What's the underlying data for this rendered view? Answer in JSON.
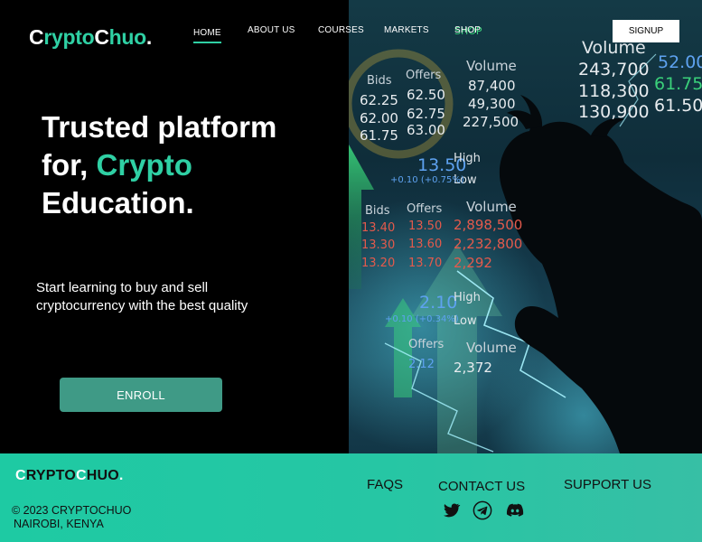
{
  "header": {
    "logo_first": "C",
    "logo_mid": "rypto",
    "logo_c2": "C",
    "logo_rest": "huo",
    "logo_dot": ".",
    "nav": [
      "HOME",
      "ABOUT US",
      "COURSES",
      "MARKETS",
      "SHOP"
    ],
    "signup_label": "SIGNUP"
  },
  "hero": {
    "headline_line1": "Trusted platform",
    "headline_line2_pre": "for, ",
    "headline_line2_accent": "Crypto",
    "headline_line3": "Education.",
    "subtext_line1": "Start learning to buy and sell",
    "subtext_line2": "cryptocurrency with the best quality",
    "enroll_label": "ENROLL"
  },
  "market_board": {
    "labels": [
      "Bids",
      "Offers",
      "Volume",
      "High",
      "Low",
      "Bids",
      "Offers",
      "Volume",
      "High",
      "Low",
      "Offers",
      "Volume"
    ],
    "top_block": [
      "62.25",
      "62.50",
      "87,400",
      "62.00",
      "62.75",
      "49,300",
      "61.75",
      "63.00",
      "227,500"
    ],
    "right_block": [
      "243,700",
      "118,300",
      "130,900",
      "61.75",
      "61.50",
      "52.00"
    ],
    "mid_block": [
      "13.50",
      "+0.10 (+0.75%)",
      "13.40",
      "13.50",
      "2,898,500",
      "13.30",
      "13.60",
      "2,232,800",
      "13.20",
      "13.70",
      "2,292"
    ],
    "low_block": [
      "2.10",
      "+0.10 (+0.34%)",
      "2.12",
      "2,372"
    ],
    "shop_text": "SHOP"
  },
  "footer": {
    "logo_a": "C",
    "logo_b": "RYPTO",
    "logo_c": "C",
    "logo_d": "HUO",
    "logo_dot": ".",
    "copyright": "© 2023 CRYPTOCHUO",
    "location": "NAIROBI, KENYA",
    "links": [
      "FAQS",
      "CONTACT US",
      "SUPPORT US"
    ],
    "social": [
      "twitter-icon",
      "telegram-icon",
      "discord-icon"
    ]
  },
  "colors": {
    "accent": "#2fd0a4",
    "footer_bg": "#26c6a4",
    "enroll_bg": "#3f9a86"
  }
}
